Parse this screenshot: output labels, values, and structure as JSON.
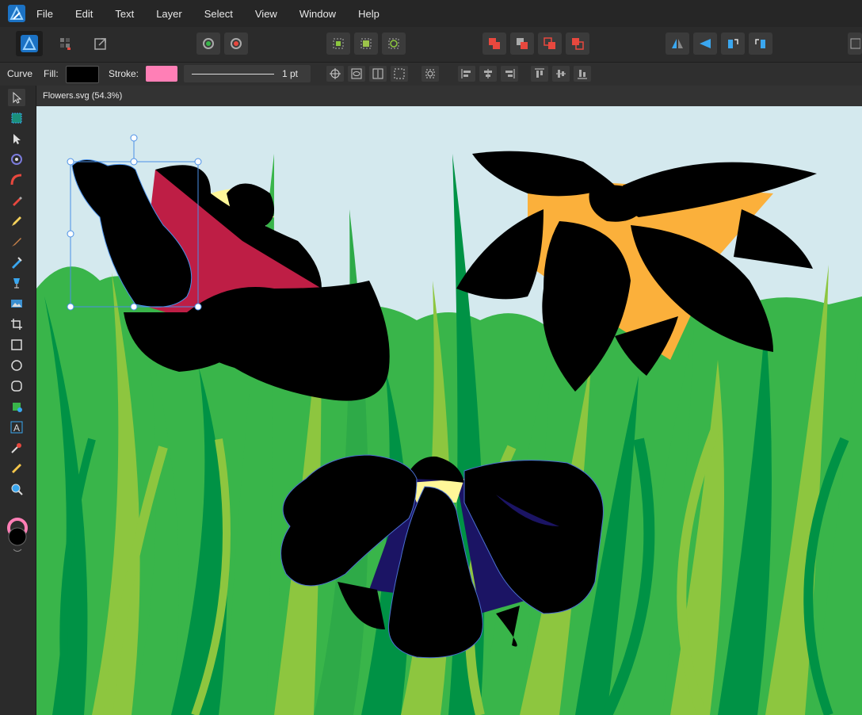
{
  "app": {
    "name": "Affinity Designer"
  },
  "menu": {
    "file": "File",
    "edit": "Edit",
    "text": "Text",
    "layer": "Layer",
    "select": "Select",
    "view": "View",
    "window": "Window",
    "help": "Help"
  },
  "context_bar": {
    "tool_label": "Curve",
    "fill_label": "Fill:",
    "fill_color": "#000000",
    "stroke_label": "Stroke:",
    "stroke_color": "#ff7fb6",
    "stroke_width": "1 pt"
  },
  "document": {
    "tab_title": "Flowers.svg (54.3%)"
  },
  "colors": {
    "sky": "#d4e9ee",
    "grass_light": "#8dc63f",
    "grass_mid": "#39b54a",
    "grass_dark": "#009245",
    "petal_orange": "#fbb03b",
    "petal_crimson": "#be1e45",
    "petal_indigo": "#1b1464",
    "petal_yellow": "#fff799",
    "selection": "#4a8fe7",
    "accent_blue": "#3aa7f0",
    "accent_red": "#e8483e"
  },
  "toolbar_icons": [
    "designer-persona-icon",
    "pixel-persona-icon",
    "export-persona-icon",
    "snapping-icon",
    "snapping-options-icon",
    "grid-select-icon",
    "grid-pixel-icon",
    "constraint-icon",
    "boolean-add-icon",
    "boolean-subtract-icon",
    "boolean-intersect-icon",
    "boolean-xor-icon",
    "flip-horizontal-icon",
    "flip-vertical-icon",
    "rotate-left-icon",
    "rotate-right-icon"
  ],
  "tools": [
    "move-tool-icon",
    "artboard-tool-icon",
    "node-tool-icon",
    "point-transform-icon",
    "corner-tool-icon",
    "pen-tool-icon",
    "pencil-tool-icon",
    "vector-brush-icon",
    "fill-tool-icon",
    "transparency-tool-icon",
    "place-image-icon",
    "crop-tool-icon",
    "rectangle-tool-icon",
    "ellipse-tool-icon",
    "rounded-rect-tool-icon",
    "shape-tool-icon",
    "text-tool-icon",
    "color-picker-icon",
    "measure-tool-icon",
    "zoom-tool-icon"
  ]
}
